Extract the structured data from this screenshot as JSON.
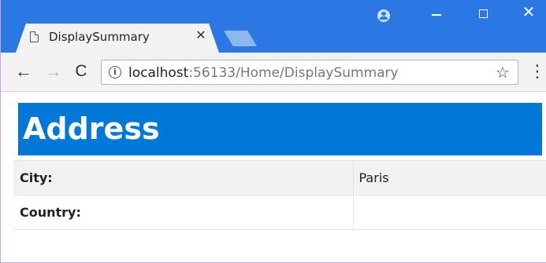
{
  "browser": {
    "tab": {
      "title": "DisplaySummary",
      "close_glyph": "✕"
    },
    "window_controls": {
      "minimize": "minimize-icon",
      "maximize": "maximize-icon",
      "close_glyph": "✕"
    },
    "toolbar": {
      "back_glyph": "←",
      "forward_glyph": "→",
      "reload_glyph": "C",
      "url_host": "localhost",
      "url_rest": ":56133/Home/DisplaySummary",
      "star_glyph": "☆",
      "menu_glyph": "⋮"
    },
    "colors": {
      "titlebar": "#2b78e4",
      "tab": "#f2f2f2"
    }
  },
  "page": {
    "heading": "Address",
    "heading_color": "#0078d7",
    "rows": [
      {
        "label": "City:",
        "value": "Paris"
      },
      {
        "label": "Country:",
        "value": ""
      }
    ]
  }
}
